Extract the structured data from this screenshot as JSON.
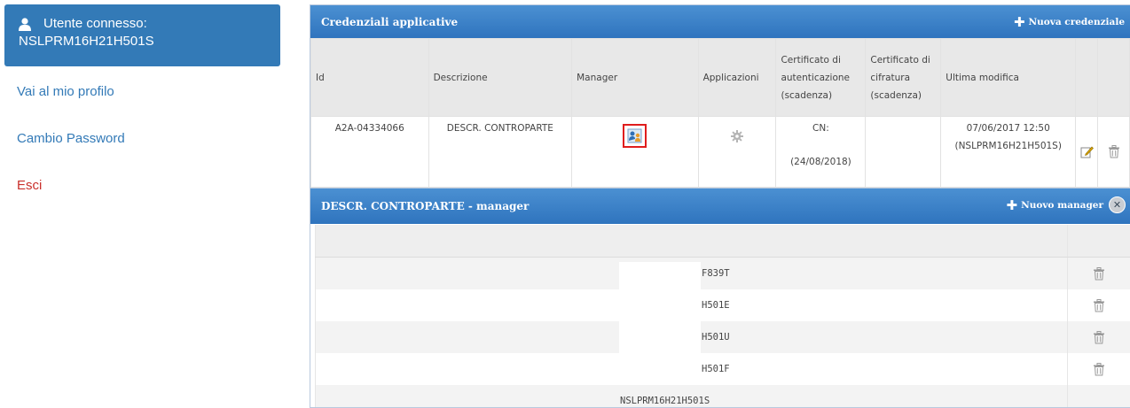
{
  "sidebar": {
    "user_label": "Utente connesso:",
    "user_code": "NSLPRM16H21H501S",
    "links": [
      "Vai al mio profilo",
      "Cambio Password",
      "Esci"
    ]
  },
  "credentials": {
    "title": "Credenziali applicative",
    "new_label": "Nuova credenziale",
    "columns": [
      "Id",
      "Descrizione",
      "Manager",
      "Applicazioni",
      "Certificato di autenticazione (scadenza)",
      "Certificato di cifratura (scadenza)",
      "Ultima modifica"
    ],
    "row": {
      "id": "A2A-04334066",
      "description": "DESCR. CONTROPARTE",
      "cert_auth_cn": "CN:",
      "cert_auth_date": "(24/08/2018)",
      "cert_cipher": "",
      "modified_date": "07/06/2017 12:50",
      "modified_by": "(NSLPRM16H21H501S)"
    }
  },
  "managers": {
    "title": "DESCR. CONTROPARTE - manager",
    "new_label": "Nuovo manager",
    "rows": [
      "F839T",
      "H501E",
      "H501U",
      "H501F",
      "NSLPRM16H21H501S"
    ]
  },
  "colors": {
    "header_blue": "#337ab7",
    "link_blue": "#337ab7",
    "logout_red": "#c9302c",
    "highlight_red": "#e01d1d"
  }
}
